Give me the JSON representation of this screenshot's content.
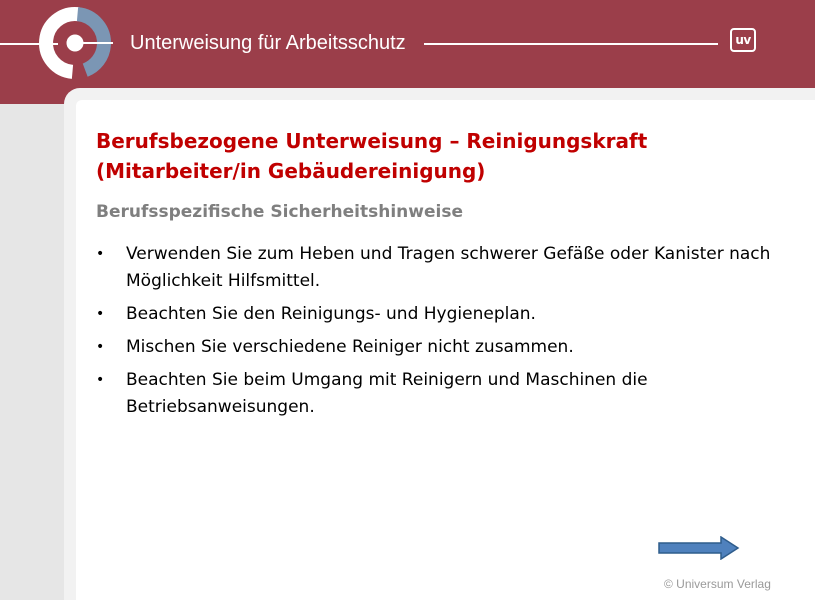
{
  "header": {
    "title": "Unterweisung für Arbeitsschutz",
    "badge_text": "uv"
  },
  "slide": {
    "title": "Berufsbezogene Unterweisung – Reinigungskraft (Mitarbeiter/in Gebäudereinigung)",
    "subtitle": "Berufsspezifische Sicherheitshinweise",
    "bullet_symbol": "•",
    "bullets": [
      "Verwenden Sie zum Heben und Tragen schwerer Gefäße oder Kanister nach Möglichkeit Hilfsmittel.",
      "Beachten Sie den Reinigungs- und Hygieneplan.",
      "Mischen Sie verschiedene Reiniger nicht zusammen.",
      "Beachten Sie beim Umgang mit Reinigern und Maschinen die Betriebsanweisungen."
    ]
  },
  "footer": {
    "copyright": "© Universum Verlag"
  },
  "colors": {
    "header_bg": "#9b3e4a",
    "title": "#c00000",
    "subtitle": "#7f7f7f",
    "arrow_fill": "#4f81bd"
  },
  "icons": {
    "logo": "ring-logo",
    "next": "right-arrow-icon"
  }
}
